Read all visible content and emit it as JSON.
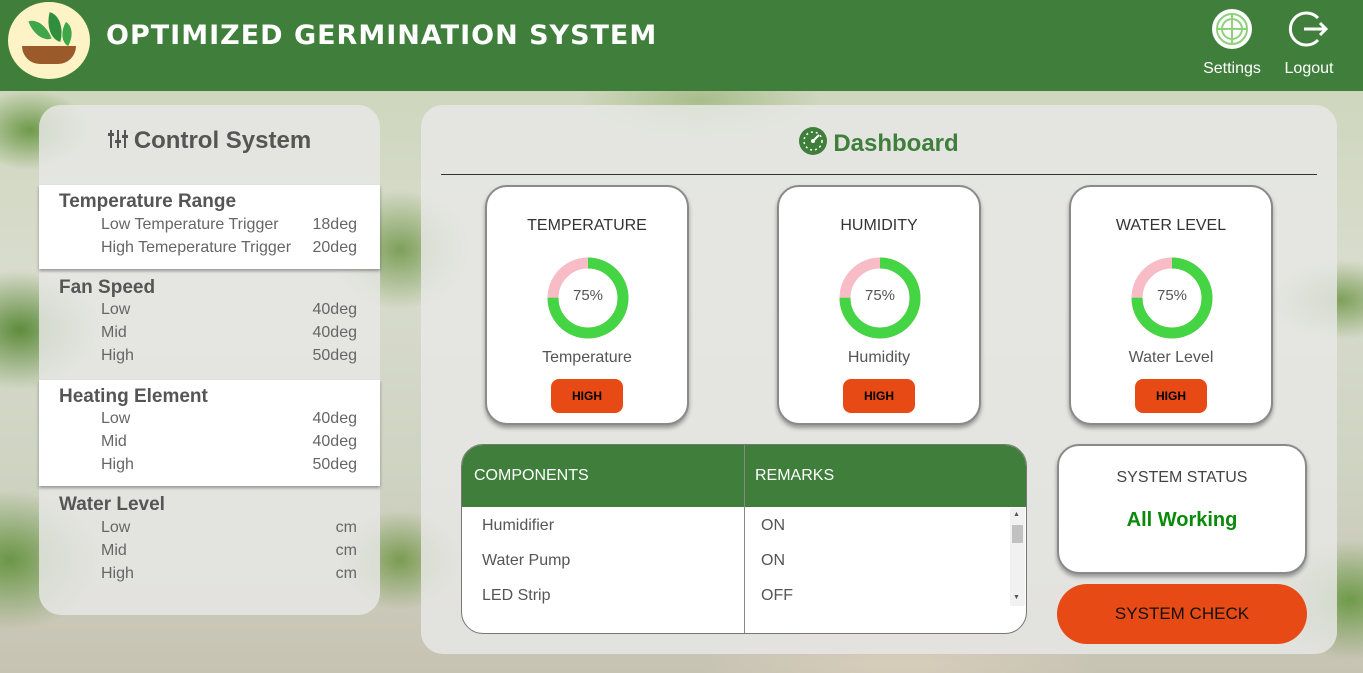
{
  "header": {
    "title": "OPTIMIZED GERMINATION SYSTEM",
    "settings_label": "Settings",
    "logout_label": "Logout",
    "brand_color": "#3f7f3b"
  },
  "control": {
    "title": "Control System",
    "groups": [
      {
        "title": "Temperature Range",
        "rows": [
          {
            "label": "Low Temperature Trigger",
            "value": "18deg"
          },
          {
            "label": "High Temeperature Trigger",
            "value": "20deg"
          }
        ]
      },
      {
        "title": "Fan Speed",
        "rows": [
          {
            "label": "Low",
            "value": "40deg"
          },
          {
            "label": "Mid",
            "value": "40deg"
          },
          {
            "label": "High",
            "value": "50deg"
          }
        ]
      },
      {
        "title": "Heating Element",
        "rows": [
          {
            "label": "Low",
            "value": "40deg"
          },
          {
            "label": "Mid",
            "value": "40deg"
          },
          {
            "label": "High",
            "value": "50deg"
          }
        ]
      },
      {
        "title": "Water Level",
        "rows": [
          {
            "label": "Low",
            "value": "cm"
          },
          {
            "label": "Mid",
            "value": "cm"
          },
          {
            "label": "High",
            "value": "cm"
          }
        ]
      }
    ]
  },
  "dashboard": {
    "title": "Dashboard",
    "cards": [
      {
        "title": "TEMPERATURE",
        "percent_label": "75%",
        "percent": 75,
        "subtitle": "Temperature",
        "button": "HIGH"
      },
      {
        "title": "HUMIDITY",
        "percent_label": "75%",
        "percent": 75,
        "subtitle": "Humidity",
        "button": "HIGH"
      },
      {
        "title": "WATER LEVEL",
        "percent_label": "75%",
        "percent": 75,
        "subtitle": "Water Level",
        "button": "HIGH"
      }
    ],
    "gauge_colors": {
      "filled": "#44d444",
      "remaining": "#f7bcc6"
    },
    "table": {
      "headers": [
        "COMPONENTS",
        "REMARKS"
      ],
      "rows": [
        {
          "component": "Humidifier",
          "remark": "ON"
        },
        {
          "component": "Water Pump",
          "remark": "ON"
        },
        {
          "component": "LED Strip",
          "remark": "OFF"
        }
      ]
    },
    "status": {
      "title": "SYSTEM STATUS",
      "value": "All Working",
      "value_color": "#0a8a0a"
    },
    "check_button": "SYSTEM CHECK",
    "accent_button_color": "#e84a15"
  }
}
